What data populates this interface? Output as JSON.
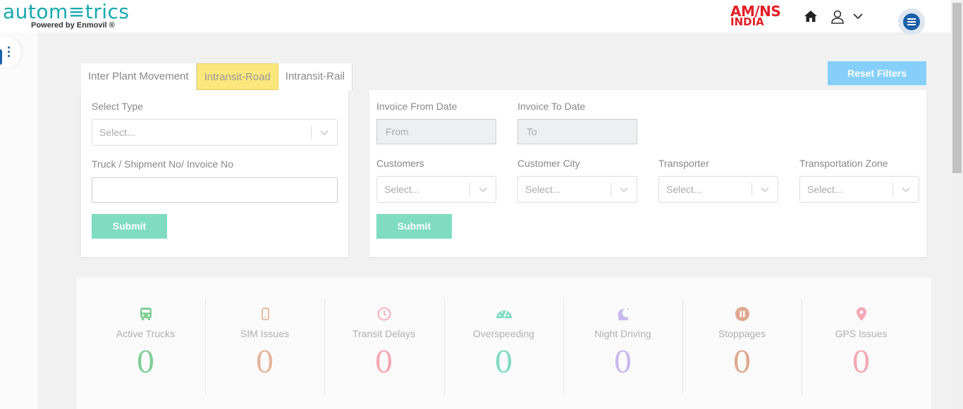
{
  "header": {
    "logo_text": "autom≡trics",
    "logo_sub": "Powered by Enmovil ®",
    "brand_line1": "AM/NS",
    "brand_line2": "INDIA",
    "icons": [
      "home-icon",
      "user-icon",
      "chevron-down-icon",
      "menu-icon"
    ]
  },
  "tabs": [
    {
      "label": "Inter Plant Movement",
      "active": false
    },
    {
      "label": "Intransit-Road",
      "active": true
    },
    {
      "label": "Intransit-Rail",
      "active": false
    }
  ],
  "reset_filters_label": "Reset Filters",
  "left_panel": {
    "select_type_label": "Select Type",
    "select_type_placeholder": "Select...",
    "search_label": "Truck / Shipment No/ Invoice No",
    "search_value": "",
    "submit_label": "Submit"
  },
  "right_panel": {
    "invoice_from_label": "Invoice From Date",
    "invoice_from_placeholder": "From",
    "invoice_to_label": "Invoice To Date",
    "invoice_to_placeholder": "To",
    "filters": [
      {
        "label": "Customers",
        "placeholder": "Select..."
      },
      {
        "label": "Customer City",
        "placeholder": "Select..."
      },
      {
        "label": "Transporter",
        "placeholder": "Select..."
      },
      {
        "label": "Transportation Zone",
        "placeholder": "Select..."
      }
    ],
    "submit_label": "Submit"
  },
  "stats": [
    {
      "label": "Active Trucks",
      "value": "0",
      "color": "#7fcf96",
      "icon": "truck-icon"
    },
    {
      "label": "SIM Issues",
      "value": "0",
      "color": "#e5b59a",
      "icon": "mobile-icon"
    },
    {
      "label": "Transit Delays",
      "value": "0",
      "color": "#f5a7b4",
      "icon": "clock-icon"
    },
    {
      "label": "Overspeeding",
      "value": "0",
      "color": "#7fdcc1",
      "icon": "speedometer-icon"
    },
    {
      "label": "Night Driving",
      "value": "0",
      "color": "#c9b8ec",
      "icon": "moon-icon"
    },
    {
      "label": "Stoppages",
      "value": "0",
      "color": "#dfa88f",
      "icon": "pause-icon"
    },
    {
      "label": "GPS Issues",
      "value": "0",
      "color": "#f5a7b4",
      "icon": "map-pin-icon"
    }
  ]
}
